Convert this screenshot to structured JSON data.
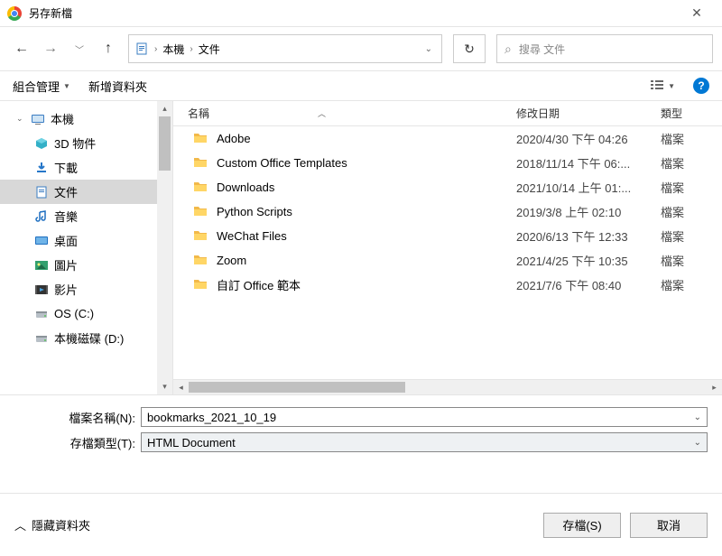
{
  "window": {
    "title": "另存新檔"
  },
  "breadcrumb": {
    "loc1": "本機",
    "loc2": "文件"
  },
  "search": {
    "placeholder": "搜尋 文件"
  },
  "toolbar": {
    "organize": "組合管理",
    "newfolder": "新增資料夾"
  },
  "columns": {
    "name": "名稱",
    "date": "修改日期",
    "type": "類型"
  },
  "tree": {
    "root": "本機",
    "items": [
      {
        "label": "3D 物件",
        "icon": "cube"
      },
      {
        "label": "下載",
        "icon": "download"
      },
      {
        "label": "文件",
        "icon": "document",
        "selected": true
      },
      {
        "label": "音樂",
        "icon": "music"
      },
      {
        "label": "桌面",
        "icon": "desktop"
      },
      {
        "label": "圖片",
        "icon": "picture"
      },
      {
        "label": "影片",
        "icon": "video"
      },
      {
        "label": "OS (C:)",
        "icon": "disk"
      },
      {
        "label": "本機磁碟 (D:)",
        "icon": "disk"
      }
    ]
  },
  "files": [
    {
      "name": "Adobe",
      "date": "2020/4/30 下午 04:26",
      "type": "檔案"
    },
    {
      "name": "Custom Office Templates",
      "date": "2018/11/14 下午 06:...",
      "type": "檔案"
    },
    {
      "name": "Downloads",
      "date": "2021/10/14 上午 01:...",
      "type": "檔案"
    },
    {
      "name": "Python Scripts",
      "date": "2019/3/8 上午 02:10",
      "type": "檔案"
    },
    {
      "name": "WeChat Files",
      "date": "2020/6/13 下午 12:33",
      "type": "檔案"
    },
    {
      "name": "Zoom",
      "date": "2021/4/25 下午 10:35",
      "type": "檔案"
    },
    {
      "name": "自訂 Office 範本",
      "date": "2021/7/6 下午 08:40",
      "type": "檔案"
    }
  ],
  "form": {
    "filename_label": "檔案名稱(N):",
    "filename_value": "bookmarks_2021_10_19",
    "filetype_label": "存檔類型(T):",
    "filetype_value": "HTML Document"
  },
  "footer": {
    "hide": "隱藏資料夾",
    "save": "存檔(S)",
    "cancel": "取消"
  }
}
